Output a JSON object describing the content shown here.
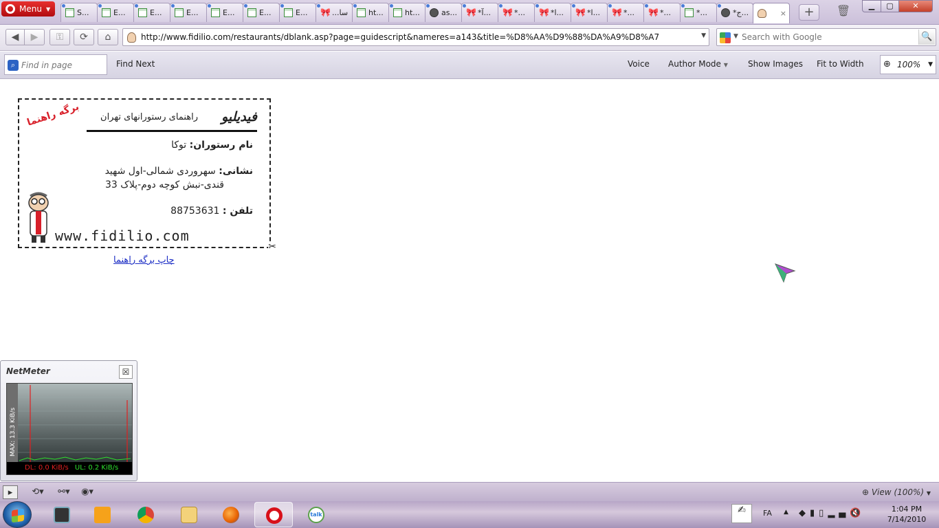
{
  "browser": {
    "menu_label": "Menu",
    "tabs": [
      {
        "label": "S...",
        "icon": "doc",
        "dot": true
      },
      {
        "label": "E...",
        "icon": "doc",
        "dot": true
      },
      {
        "label": "E...",
        "icon": "doc",
        "dot": true
      },
      {
        "label": "E...",
        "icon": "doc",
        "dot": true
      },
      {
        "label": "E...",
        "icon": "doc",
        "dot": true
      },
      {
        "label": "E...",
        "icon": "doc",
        "dot": true
      },
      {
        "label": "E...",
        "icon": "doc",
        "dot": true
      },
      {
        "label": "...سا",
        "icon": "bow",
        "dot": true
      },
      {
        "label": "ht...",
        "icon": "doc",
        "dot": true
      },
      {
        "label": "ht...",
        "icon": "doc",
        "dot": true
      },
      {
        "label": "as...",
        "icon": "globe",
        "dot": true
      },
      {
        "label": "*آ...",
        "icon": "bow",
        "dot": true
      },
      {
        "label": "*...",
        "icon": "bow",
        "dot": true
      },
      {
        "label": "*ا...",
        "icon": "bow",
        "dot": true
      },
      {
        "label": "*ا...",
        "icon": "bow",
        "dot": true
      },
      {
        "label": "*...",
        "icon": "bow",
        "dot": true
      },
      {
        "label": "*...",
        "icon": "bow",
        "dot": true
      },
      {
        "label": "*...",
        "icon": "doc",
        "dot": true
      },
      {
        "label": "*ج...",
        "icon": "globe",
        "dot": true
      },
      {
        "label": "",
        "icon": "man",
        "dot": false,
        "active": true,
        "close": "×"
      }
    ],
    "new_tab_label": "+",
    "address_value": "http://www.fidilio.com/restaurants/dblank.asp?page=guidescript&nameres=a143&title=%D8%AA%D9%88%DA%A9%D8%A7",
    "search_placeholder": "Search with Google",
    "find": {
      "placeholder": "Find in page",
      "next_label": "Find Next",
      "voice_label": "Voice",
      "author_label": "Author Mode",
      "images_label": "Show Images",
      "fit_label": "Fit to Width",
      "zoom_value": "100%"
    },
    "status_view_label": "View (100%)"
  },
  "card": {
    "stamp": "برگه راهنما",
    "brand": "فیدیلیو",
    "tagline": "راهنمای رستورانهای تهران",
    "name_label": "نام رستوران:",
    "name_value": "توکا",
    "address_label": "نشانی:",
    "address_line1": "سهروردی شمالی-اول شهید",
    "address_line2": "قندی-نبش کوچه دوم-پلاک 33",
    "phone_label": "تلفن :",
    "phone_value": "88753631",
    "site": "www.fidilio.com"
  },
  "print_link": "چاپ برگه راهنما",
  "netmeter": {
    "title": "NetMeter",
    "max_label": "MAX: 13.3 KiB/s",
    "dl_label": "DL: 0.0 KiB/s",
    "ul_label": "UL: 0.2 KiB/s"
  },
  "taskbar": {
    "lang": "FA",
    "time": "1:04 PM",
    "date": "7/14/2010",
    "talk_label": "talk"
  },
  "colors": {
    "link": "#1a2cc4",
    "stamp_red": "#d8202a",
    "dl_red": "#e02020",
    "ul_green": "#2ee02e"
  }
}
